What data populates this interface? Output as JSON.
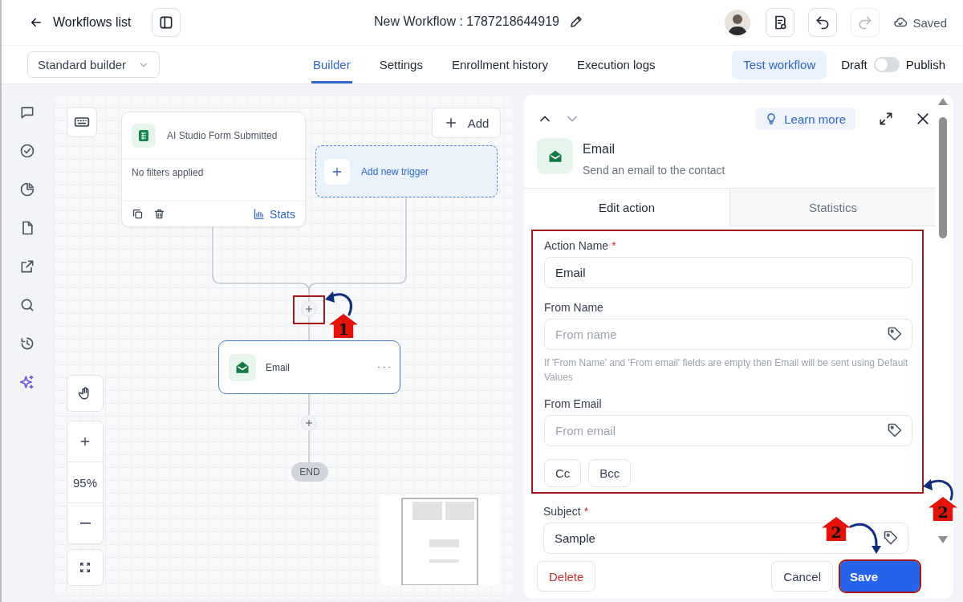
{
  "header": {
    "back_label": "Workflows list",
    "title": "New Workflow : 1787218644919",
    "status": "Saved",
    "redo_disabled": true
  },
  "builder_select": {
    "value": "Standard builder"
  },
  "tabs": [
    {
      "label": "Builder",
      "selected": true
    },
    {
      "label": "Settings",
      "selected": false
    },
    {
      "label": "Enrollment history",
      "selected": false
    },
    {
      "label": "Execution logs",
      "selected": false
    }
  ],
  "test_button": "Test workflow",
  "publish": {
    "off_label": "Draft",
    "on_label": "Publish",
    "on": false
  },
  "canvas": {
    "trigger": {
      "title": "AI Studio Form Submitted",
      "filters": "No filters applied",
      "stats_label": "Stats"
    },
    "add_button": "Add",
    "add_trigger": "Add new trigger",
    "connectors": [
      {
        "highlighted": true
      },
      {
        "highlighted": false
      }
    ],
    "action_node": {
      "label": "Email",
      "selected": true
    },
    "end_label": "END",
    "zoom": "95%"
  },
  "panel": {
    "learn_more": "Learn more",
    "action": {
      "title": "Email",
      "subtitle": "Send an email to the contact"
    },
    "tabs": [
      {
        "label": "Edit action",
        "selected": true
      },
      {
        "label": "Statistics",
        "selected": false
      }
    ],
    "group": {
      "highlighted": true,
      "fields": [
        {
          "kind": "text",
          "label": "Action Name",
          "required_mark": "*",
          "value": "Email"
        },
        {
          "kind": "tag",
          "label": "From Name",
          "placeholder": "From name",
          "help": "If 'From Name' and 'From email' fields are empty then Email will be sent using Default Values"
        },
        {
          "kind": "tag",
          "label": "From Email",
          "placeholder": "From email"
        },
        {
          "kind": "chips",
          "chips": [
            "Cc",
            "Bcc"
          ]
        }
      ]
    },
    "fields_after": [
      {
        "kind": "tag",
        "label": "Subject",
        "required_mark": "*",
        "value": "Sample"
      }
    ],
    "delete": "Delete",
    "cancel": "Cancel",
    "save": {
      "label": "Save",
      "highlighted": true
    }
  },
  "callouts": [
    {
      "number": "1"
    },
    {
      "number": "2"
    },
    {
      "number": "2"
    }
  ]
}
